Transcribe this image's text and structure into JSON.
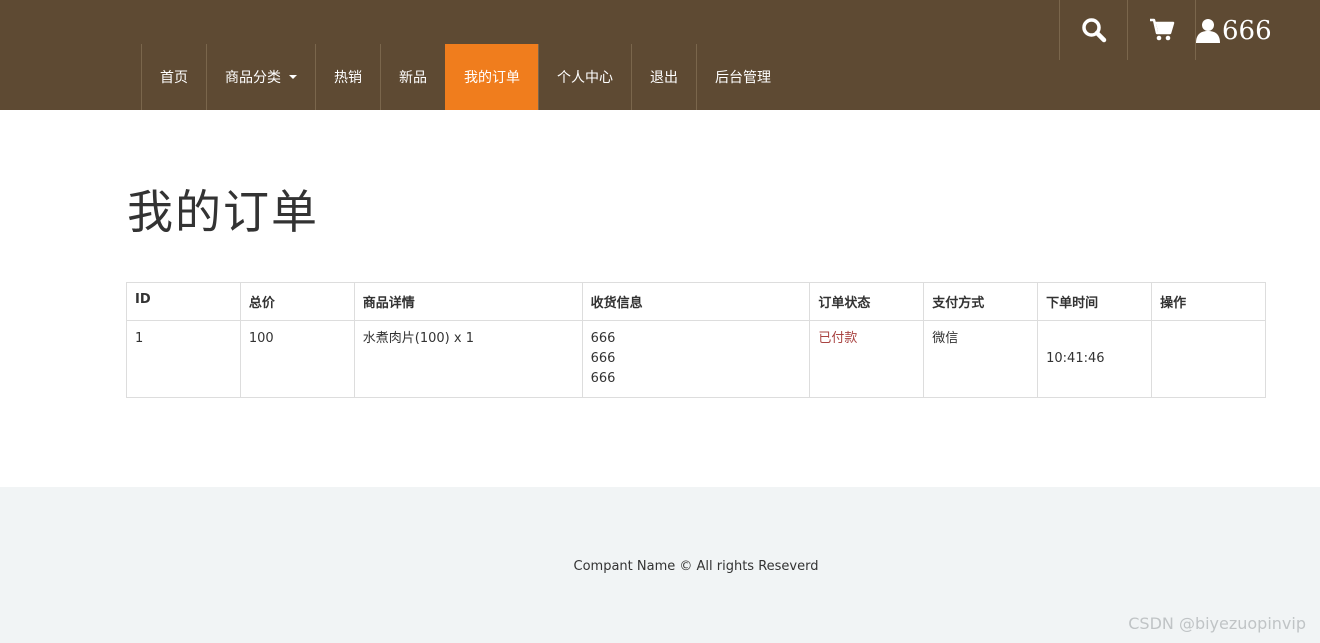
{
  "header": {
    "icons": [
      "search-icon",
      "cart-icon",
      "user-icon"
    ],
    "username": "666",
    "colors": {
      "background": "#5e4a33",
      "active": "#f07d1d"
    }
  },
  "nav": {
    "items": [
      {
        "label": "首页"
      },
      {
        "label": "商品分类"
      },
      {
        "label": "热销"
      },
      {
        "label": "新品"
      },
      {
        "label": "我的订单"
      },
      {
        "label": "个人中心"
      },
      {
        "label": "退出"
      },
      {
        "label": "后台管理"
      }
    ],
    "active_index": 4
  },
  "page": {
    "title": "我的订单"
  },
  "orders": {
    "headers": [
      "ID",
      "总价",
      "商品详情",
      "收货信息",
      "订单状态",
      "支付方式",
      "下单时间",
      "操作"
    ],
    "rows": [
      {
        "id": "1",
        "total": "100",
        "items": "水煮肉片(100) x 1",
        "shipping": [
          "666",
          "666",
          "666"
        ],
        "status": "已付款",
        "payment": "微信",
        "time": "10:41:46",
        "actions": ""
      }
    ]
  },
  "footer": {
    "copyright": "Compant Name © All rights Reseverd",
    "watermark": "CSDN @biyezuopinvip"
  }
}
